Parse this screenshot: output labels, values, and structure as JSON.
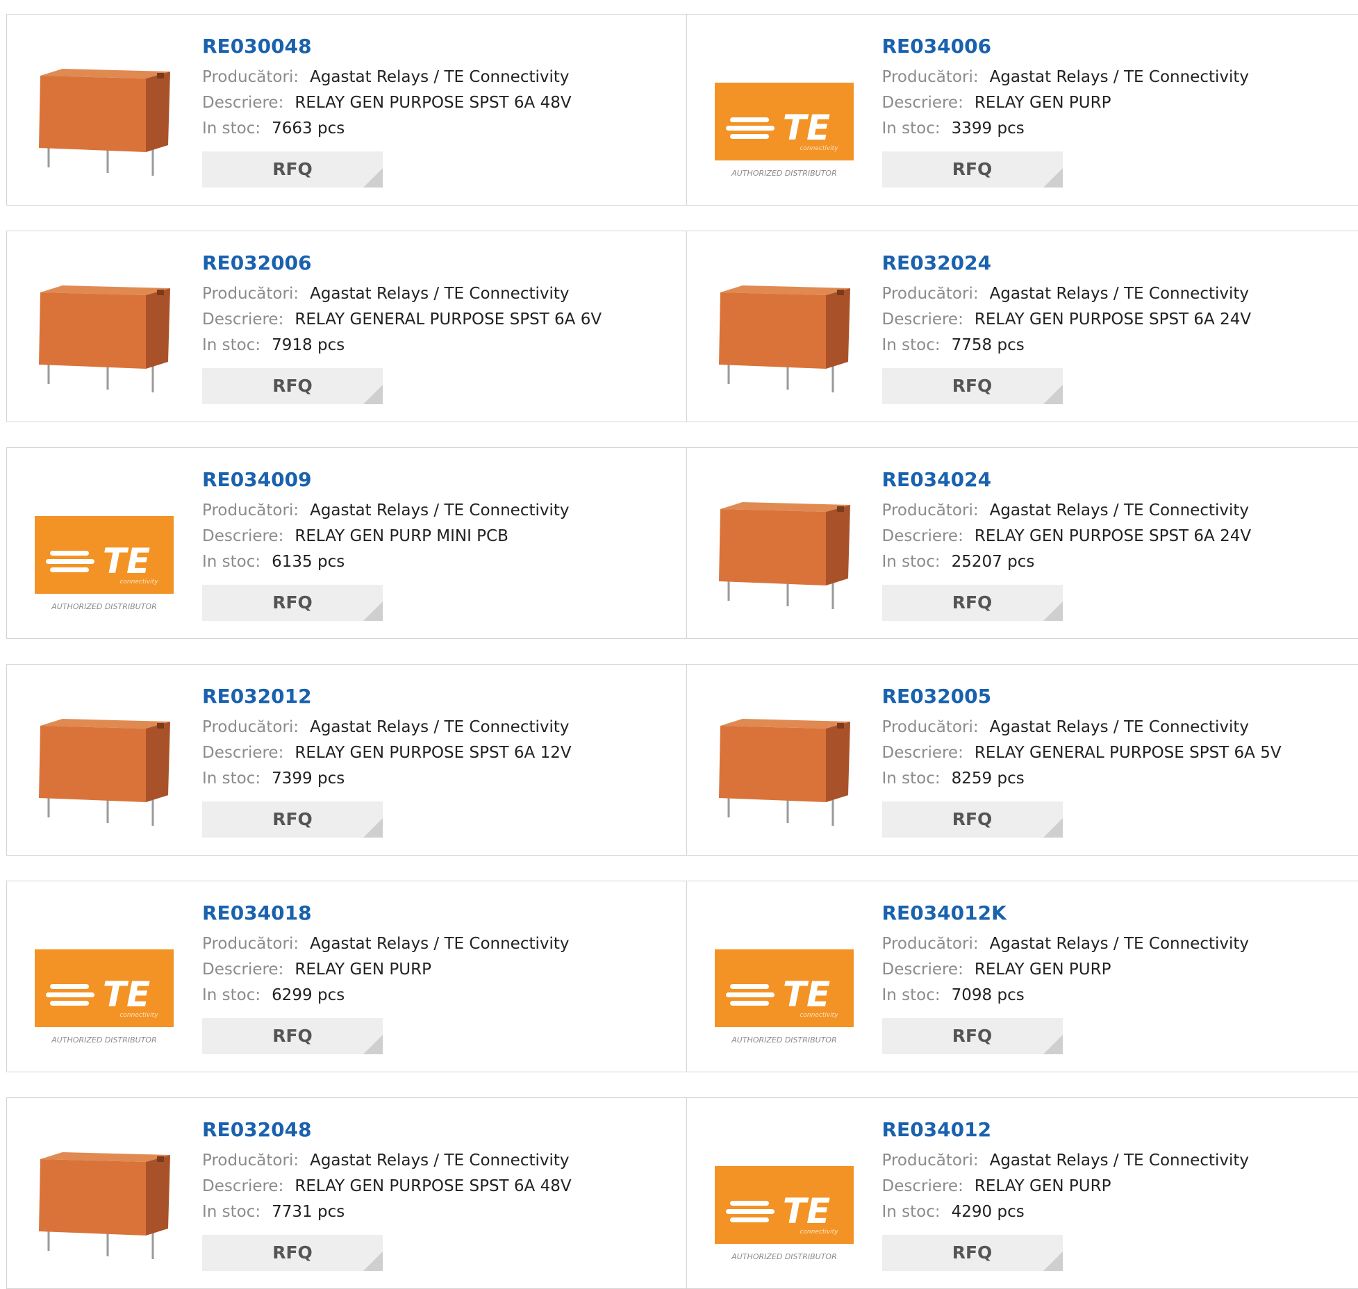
{
  "labels": {
    "manufacturer": "Producători:",
    "description": "Descriere:",
    "stock": "In stoc:",
    "rfq": "RFQ"
  },
  "colors": {
    "part_link": "#1a62ae",
    "te_orange": "#f39325",
    "relay_body": "#d9733a",
    "border": "#d4d4d4"
  },
  "te_logo": {
    "word": "TE",
    "sub": "connectivity",
    "caption": "AUTHORIZED DISTRIBUTOR"
  },
  "rows": [
    [
      {
        "part": "RE030048",
        "manufacturer": "Agastat Relays / TE Connectivity",
        "description": "RELAY GEN PURPOSE SPST 6A 48V",
        "stock": "7663 pcs",
        "image": "relay-photo"
      },
      {
        "part": "RE034006",
        "manufacturer": "Agastat Relays / TE Connectivity",
        "description": "RELAY GEN PURP",
        "stock": "3399 pcs",
        "image": "te-logo"
      }
    ],
    [
      {
        "part": "RE032006",
        "manufacturer": "Agastat Relays / TE Connectivity",
        "description": "RELAY GENERAL PURPOSE SPST 6A 6V",
        "stock": "7918 pcs",
        "image": "relay-photo"
      },
      {
        "part": "RE032024",
        "manufacturer": "Agastat Relays / TE Connectivity",
        "description": "RELAY GEN PURPOSE SPST 6A 24V",
        "stock": "7758 pcs",
        "image": "relay-photo"
      }
    ],
    [
      {
        "part": "RE034009",
        "manufacturer": "Agastat Relays / TE Connectivity",
        "description": "RELAY GEN PURP MINI PCB",
        "stock": "6135 pcs",
        "image": "te-logo"
      },
      {
        "part": "RE034024",
        "manufacturer": "Agastat Relays / TE Connectivity",
        "description": "RELAY GEN PURPOSE SPST 6A 24V",
        "stock": "25207 pcs",
        "image": "relay-photo"
      }
    ],
    [
      {
        "part": "RE032012",
        "manufacturer": "Agastat Relays / TE Connectivity",
        "description": "RELAY GEN PURPOSE SPST 6A 12V",
        "stock": "7399 pcs",
        "image": "relay-photo"
      },
      {
        "part": "RE032005",
        "manufacturer": "Agastat Relays / TE Connectivity",
        "description": "RELAY GENERAL PURPOSE SPST 6A 5V",
        "stock": "8259 pcs",
        "image": "relay-photo"
      }
    ],
    [
      {
        "part": "RE034018",
        "manufacturer": "Agastat Relays / TE Connectivity",
        "description": "RELAY GEN PURP",
        "stock": "6299 pcs",
        "image": "te-logo"
      },
      {
        "part": "RE034012K",
        "manufacturer": "Agastat Relays / TE Connectivity",
        "description": "RELAY GEN PURP",
        "stock": "7098 pcs",
        "image": "te-logo"
      }
    ],
    [
      {
        "part": "RE032048",
        "manufacturer": "Agastat Relays / TE Connectivity",
        "description": "RELAY GEN PURPOSE SPST 6A 48V",
        "stock": "7731 pcs",
        "image": "relay-photo"
      },
      {
        "part": "RE034012",
        "manufacturer": "Agastat Relays / TE Connectivity",
        "description": "RELAY GEN PURP",
        "stock": "4290 pcs",
        "image": "te-logo"
      }
    ]
  ]
}
